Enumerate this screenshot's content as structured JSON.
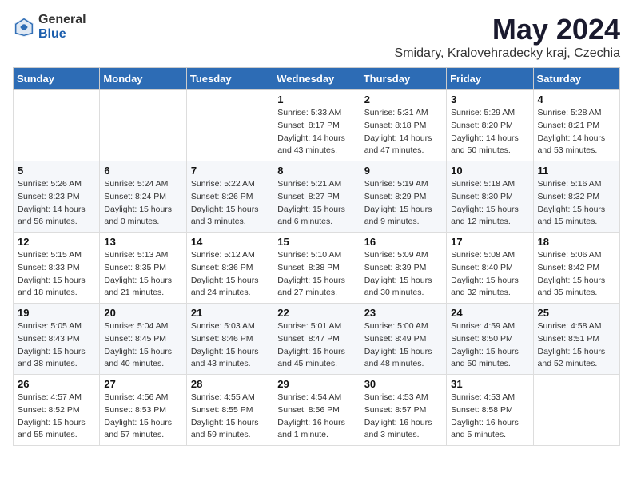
{
  "logo": {
    "general": "General",
    "blue": "Blue"
  },
  "header": {
    "month": "May 2024",
    "location": "Smidary, Kralovehradecky kraj, Czechia"
  },
  "weekdays": [
    "Sunday",
    "Monday",
    "Tuesday",
    "Wednesday",
    "Thursday",
    "Friday",
    "Saturday"
  ],
  "weeks": [
    [
      {
        "day": "",
        "info": ""
      },
      {
        "day": "",
        "info": ""
      },
      {
        "day": "",
        "info": ""
      },
      {
        "day": "1",
        "info": "Sunrise: 5:33 AM\nSunset: 8:17 PM\nDaylight: 14 hours\nand 43 minutes."
      },
      {
        "day": "2",
        "info": "Sunrise: 5:31 AM\nSunset: 8:18 PM\nDaylight: 14 hours\nand 47 minutes."
      },
      {
        "day": "3",
        "info": "Sunrise: 5:29 AM\nSunset: 8:20 PM\nDaylight: 14 hours\nand 50 minutes."
      },
      {
        "day": "4",
        "info": "Sunrise: 5:28 AM\nSunset: 8:21 PM\nDaylight: 14 hours\nand 53 minutes."
      }
    ],
    [
      {
        "day": "5",
        "info": "Sunrise: 5:26 AM\nSunset: 8:23 PM\nDaylight: 14 hours\nand 56 minutes."
      },
      {
        "day": "6",
        "info": "Sunrise: 5:24 AM\nSunset: 8:24 PM\nDaylight: 15 hours\nand 0 minutes."
      },
      {
        "day": "7",
        "info": "Sunrise: 5:22 AM\nSunset: 8:26 PM\nDaylight: 15 hours\nand 3 minutes."
      },
      {
        "day": "8",
        "info": "Sunrise: 5:21 AM\nSunset: 8:27 PM\nDaylight: 15 hours\nand 6 minutes."
      },
      {
        "day": "9",
        "info": "Sunrise: 5:19 AM\nSunset: 8:29 PM\nDaylight: 15 hours\nand 9 minutes."
      },
      {
        "day": "10",
        "info": "Sunrise: 5:18 AM\nSunset: 8:30 PM\nDaylight: 15 hours\nand 12 minutes."
      },
      {
        "day": "11",
        "info": "Sunrise: 5:16 AM\nSunset: 8:32 PM\nDaylight: 15 hours\nand 15 minutes."
      }
    ],
    [
      {
        "day": "12",
        "info": "Sunrise: 5:15 AM\nSunset: 8:33 PM\nDaylight: 15 hours\nand 18 minutes."
      },
      {
        "day": "13",
        "info": "Sunrise: 5:13 AM\nSunset: 8:35 PM\nDaylight: 15 hours\nand 21 minutes."
      },
      {
        "day": "14",
        "info": "Sunrise: 5:12 AM\nSunset: 8:36 PM\nDaylight: 15 hours\nand 24 minutes."
      },
      {
        "day": "15",
        "info": "Sunrise: 5:10 AM\nSunset: 8:38 PM\nDaylight: 15 hours\nand 27 minutes."
      },
      {
        "day": "16",
        "info": "Sunrise: 5:09 AM\nSunset: 8:39 PM\nDaylight: 15 hours\nand 30 minutes."
      },
      {
        "day": "17",
        "info": "Sunrise: 5:08 AM\nSunset: 8:40 PM\nDaylight: 15 hours\nand 32 minutes."
      },
      {
        "day": "18",
        "info": "Sunrise: 5:06 AM\nSunset: 8:42 PM\nDaylight: 15 hours\nand 35 minutes."
      }
    ],
    [
      {
        "day": "19",
        "info": "Sunrise: 5:05 AM\nSunset: 8:43 PM\nDaylight: 15 hours\nand 38 minutes."
      },
      {
        "day": "20",
        "info": "Sunrise: 5:04 AM\nSunset: 8:45 PM\nDaylight: 15 hours\nand 40 minutes."
      },
      {
        "day": "21",
        "info": "Sunrise: 5:03 AM\nSunset: 8:46 PM\nDaylight: 15 hours\nand 43 minutes."
      },
      {
        "day": "22",
        "info": "Sunrise: 5:01 AM\nSunset: 8:47 PM\nDaylight: 15 hours\nand 45 minutes."
      },
      {
        "day": "23",
        "info": "Sunrise: 5:00 AM\nSunset: 8:49 PM\nDaylight: 15 hours\nand 48 minutes."
      },
      {
        "day": "24",
        "info": "Sunrise: 4:59 AM\nSunset: 8:50 PM\nDaylight: 15 hours\nand 50 minutes."
      },
      {
        "day": "25",
        "info": "Sunrise: 4:58 AM\nSunset: 8:51 PM\nDaylight: 15 hours\nand 52 minutes."
      }
    ],
    [
      {
        "day": "26",
        "info": "Sunrise: 4:57 AM\nSunset: 8:52 PM\nDaylight: 15 hours\nand 55 minutes."
      },
      {
        "day": "27",
        "info": "Sunrise: 4:56 AM\nSunset: 8:53 PM\nDaylight: 15 hours\nand 57 minutes."
      },
      {
        "day": "28",
        "info": "Sunrise: 4:55 AM\nSunset: 8:55 PM\nDaylight: 15 hours\nand 59 minutes."
      },
      {
        "day": "29",
        "info": "Sunrise: 4:54 AM\nSunset: 8:56 PM\nDaylight: 16 hours\nand 1 minute."
      },
      {
        "day": "30",
        "info": "Sunrise: 4:53 AM\nSunset: 8:57 PM\nDaylight: 16 hours\nand 3 minutes."
      },
      {
        "day": "31",
        "info": "Sunrise: 4:53 AM\nSunset: 8:58 PM\nDaylight: 16 hours\nand 5 minutes."
      },
      {
        "day": "",
        "info": ""
      }
    ]
  ]
}
